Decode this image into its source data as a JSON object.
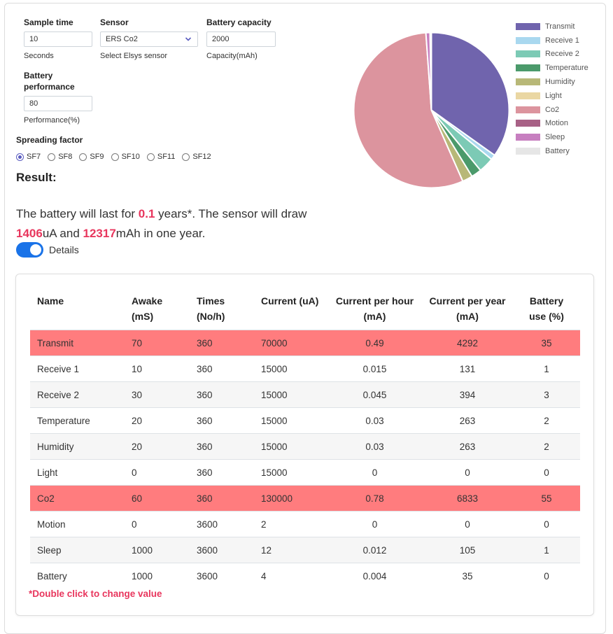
{
  "form": {
    "sample_time": {
      "label": "Sample time",
      "value": "10",
      "help": "Seconds"
    },
    "sensor": {
      "label": "Sensor",
      "value": "ERS Co2",
      "help": "Select Elsys sensor"
    },
    "battery_capacity": {
      "label": "Battery capacity",
      "value": "2000",
      "help": "Capacity(mAh)"
    },
    "battery_performance": {
      "label": "Battery performance",
      "value": "80",
      "help": "Performance(%)"
    },
    "spreading_factor": {
      "label": "Spreading factor",
      "options": [
        "SF7",
        "SF8",
        "SF9",
        "SF10",
        "SF11",
        "SF12"
      ],
      "selected": "SF7"
    }
  },
  "result": {
    "title": "Result:",
    "p1": "The battery will last for ",
    "years": "0.1",
    "p2": " years*. The sensor will draw",
    "ua": "1406",
    "p3": "uA and ",
    "mah": "12317",
    "p4": "mAh in one year."
  },
  "details": {
    "label": "Details",
    "on": true
  },
  "table": {
    "headers": [
      "Name",
      "Awake (mS)",
      "Times (No/h)",
      "Current (uA)",
      "Current per hour (mA)",
      "Current per year (mA)",
      "Battery use (%)"
    ],
    "rows": [
      {
        "name": "Transmit",
        "awake": "70",
        "times": "360",
        "current": "70000",
        "per_hour": "0.49",
        "per_year": "4292",
        "battery_use": "35",
        "highlight": true
      },
      {
        "name": "Receive 1",
        "awake": "10",
        "times": "360",
        "current": "15000",
        "per_hour": "0.015",
        "per_year": "131",
        "battery_use": "1",
        "highlight": false
      },
      {
        "name": "Receive 2",
        "awake": "30",
        "times": "360",
        "current": "15000",
        "per_hour": "0.045",
        "per_year": "394",
        "battery_use": "3",
        "highlight": false
      },
      {
        "name": "Temperature",
        "awake": "20",
        "times": "360",
        "current": "15000",
        "per_hour": "0.03",
        "per_year": "263",
        "battery_use": "2",
        "highlight": false
      },
      {
        "name": "Humidity",
        "awake": "20",
        "times": "360",
        "current": "15000",
        "per_hour": "0.03",
        "per_year": "263",
        "battery_use": "2",
        "highlight": false
      },
      {
        "name": "Light",
        "awake": "0",
        "times": "360",
        "current": "15000",
        "per_hour": "0",
        "per_year": "0",
        "battery_use": "0",
        "highlight": false
      },
      {
        "name": "Co2",
        "awake": "60",
        "times": "360",
        "current": "130000",
        "per_hour": "0.78",
        "per_year": "6833",
        "battery_use": "55",
        "highlight": true
      },
      {
        "name": "Motion",
        "awake": "0",
        "times": "3600",
        "current": "2",
        "per_hour": "0",
        "per_year": "0",
        "battery_use": "0",
        "highlight": false
      },
      {
        "name": "Sleep",
        "awake": "1000",
        "times": "3600",
        "current": "12",
        "per_hour": "0.012",
        "per_year": "105",
        "battery_use": "1",
        "highlight": false
      },
      {
        "name": "Battery",
        "awake": "1000",
        "times": "3600",
        "current": "4",
        "per_hour": "0.004",
        "per_year": "35",
        "battery_use": "0",
        "highlight": false
      }
    ],
    "note": "*Double click to change value"
  },
  "colors": {
    "accent": "#5a5cbf",
    "highlight_row": "#ff7c7e",
    "highlight_text": "#e8365d",
    "toggle": "#1a73e8"
  },
  "chart_data": {
    "type": "pie",
    "legend_position": "right",
    "series": [
      {
        "label": "Transmit",
        "value": 4292,
        "color": "#7064ad"
      },
      {
        "label": "Receive 1",
        "value": 131,
        "color": "#a9d8ef"
      },
      {
        "label": "Receive 2",
        "value": 394,
        "color": "#7ccab5"
      },
      {
        "label": "Temperature",
        "value": 263,
        "color": "#4b9a6b"
      },
      {
        "label": "Humidity",
        "value": 263,
        "color": "#b8b878"
      },
      {
        "label": "Light",
        "value": 0,
        "color": "#ead7a3"
      },
      {
        "label": "Co2",
        "value": 6833,
        "color": "#dc949e"
      },
      {
        "label": "Motion",
        "value": 0,
        "color": "#a86186"
      },
      {
        "label": "Sleep",
        "value": 105,
        "color": "#c77fc0"
      },
      {
        "label": "Battery",
        "value": 35,
        "color": "#e6e6e6"
      }
    ]
  }
}
